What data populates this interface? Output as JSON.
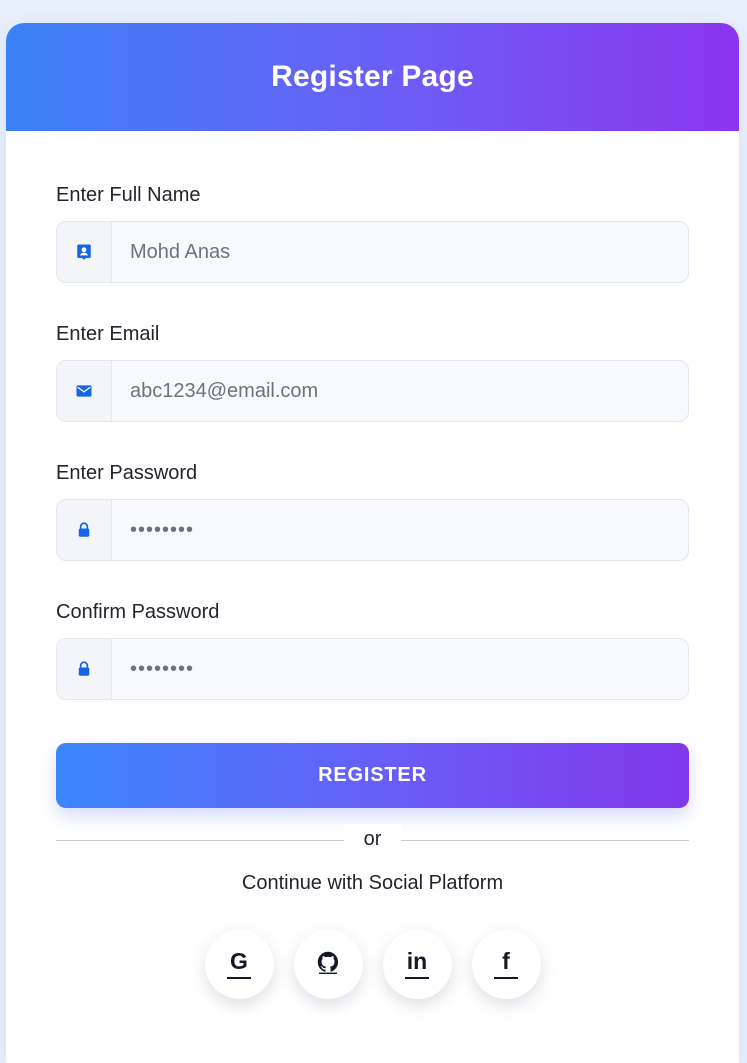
{
  "header": {
    "title": "Register Page"
  },
  "form": {
    "full_name": {
      "label": "Enter Full Name",
      "placeholder": "Mohd Anas",
      "icon": "user-badge-icon"
    },
    "email": {
      "label": "Enter Email",
      "placeholder": "abc1234@email.com",
      "icon": "envelope-icon"
    },
    "password": {
      "label": "Enter Password",
      "value": "••••••••",
      "icon": "lock-icon"
    },
    "confirm_password": {
      "label": "Confirm Password",
      "value": "••••••••",
      "icon": "lock-icon"
    },
    "submit_label": "REGISTER"
  },
  "divider": {
    "text": "or"
  },
  "social": {
    "prompt": "Continue with Social Platform",
    "buttons": [
      {
        "name": "google",
        "glyph": "G",
        "icon": "google-icon"
      },
      {
        "name": "github",
        "glyph": "",
        "icon": "github-icon"
      },
      {
        "name": "linkedin",
        "glyph": "in",
        "icon": "linkedin-icon"
      },
      {
        "name": "facebook",
        "glyph": "f",
        "icon": "facebook-icon"
      }
    ]
  },
  "colors": {
    "accent_start": "#3b82f6",
    "accent_end": "#8b35ee",
    "icon_blue": "#1565e8"
  }
}
